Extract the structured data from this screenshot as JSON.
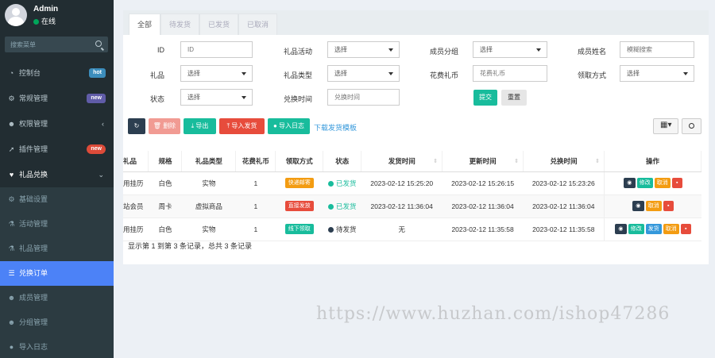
{
  "user": {
    "name": "Admin",
    "status": "在线"
  },
  "search": {
    "placeholder": "搜索菜单"
  },
  "menu": [
    {
      "label": "控制台",
      "icon": "dashboard-icon",
      "badge": "hot"
    },
    {
      "label": "常规管理",
      "icon": "cogs-icon",
      "badge": "new"
    },
    {
      "label": "权限管理",
      "icon": "group-icon",
      "chevron": "‹"
    },
    {
      "label": "插件管理",
      "icon": "rocket-icon",
      "badge": "new"
    },
    {
      "label": "礼品兑换",
      "icon": "heart-icon",
      "chevron": "⌄"
    }
  ],
  "submenu": [
    {
      "label": "基础设置",
      "icon": "cogs-icon"
    },
    {
      "label": "活动管理",
      "icon": "flask-icon"
    },
    {
      "label": "礼品管理",
      "icon": "gift-icon"
    },
    {
      "label": "兑换订单",
      "icon": "list-icon",
      "active": true
    },
    {
      "label": "成员管理",
      "icon": "user-icon"
    },
    {
      "label": "分组管理",
      "icon": "users-icon"
    },
    {
      "label": "导入日志",
      "icon": "tint-icon"
    }
  ],
  "tabs": [
    "全部",
    "待发货",
    "已发货",
    "已取消"
  ],
  "filters": {
    "id": {
      "label": "ID",
      "placeholder": "ID"
    },
    "activity": {
      "label": "礼品活动",
      "value": "选择"
    },
    "member_group": {
      "label": "成员分组",
      "value": "选择"
    },
    "member_name": {
      "label": "成员姓名",
      "placeholder": "模糊搜索"
    },
    "gift": {
      "label": "礼品",
      "value": "选择"
    },
    "gift_type": {
      "label": "礼品类型",
      "value": "选择"
    },
    "coin": {
      "label": "花费礼币",
      "placeholder": "花费礼币"
    },
    "receive_method": {
      "label": "领取方式",
      "value": "选择"
    },
    "status": {
      "label": "状态",
      "value": "选择"
    },
    "exchange_time": {
      "label": "兑换时间",
      "placeholder": "兑换时间"
    },
    "submit": "提交",
    "reset": "重置"
  },
  "toolbar": {
    "delete": "删除",
    "export": "导出",
    "import_ship": "导入发货",
    "import_log": "导入日志",
    "download_template": "下载发货模板"
  },
  "table": {
    "headers": [
      "礼品",
      "规格",
      "礼品类型",
      "花费礼币",
      "领取方式",
      "状态",
      "发货时间",
      "更新时间",
      "兑换时间",
      "操作"
    ],
    "rows": [
      {
        "gift": "用挂历",
        "spec": "白色",
        "type": "实物",
        "coin": "1",
        "method": "快递邮寄",
        "method_color": "orange",
        "status": "已发货",
        "status_color": "#18bc9c",
        "ship_time": "2023-02-12 15:25:20",
        "update_time": "2023-02-12 15:26:15",
        "exchange_time": "2023-02-12 15:23:26",
        "ops": [
          "修改",
          "取消"
        ]
      },
      {
        "gift": "站会员",
        "spec": "周卡",
        "type": "虚拟商品",
        "coin": "1",
        "method": "直接发放",
        "method_color": "red",
        "status": "已发货",
        "status_color": "#18bc9c",
        "ship_time": "2023-02-12 11:36:04",
        "update_time": "2023-02-12 11:36:04",
        "exchange_time": "2023-02-12 11:36:04",
        "ops": [
          "取消"
        ]
      },
      {
        "gift": "用挂历",
        "spec": "白色",
        "type": "实物",
        "coin": "1",
        "method": "线下领取",
        "method_color": "green",
        "status": "待发货",
        "status_color": "#2c3e50",
        "ship_time": "无",
        "update_time": "2023-02-12 11:35:58",
        "exchange_time": "2023-02-12 11:35:58",
        "ops": [
          "修改",
          "发货",
          "取消"
        ]
      }
    ]
  },
  "footer": "显示第 1 到第 3 条记录，总共 3 条记录",
  "watermark": "https://www.huzhan.com/ishop47286"
}
